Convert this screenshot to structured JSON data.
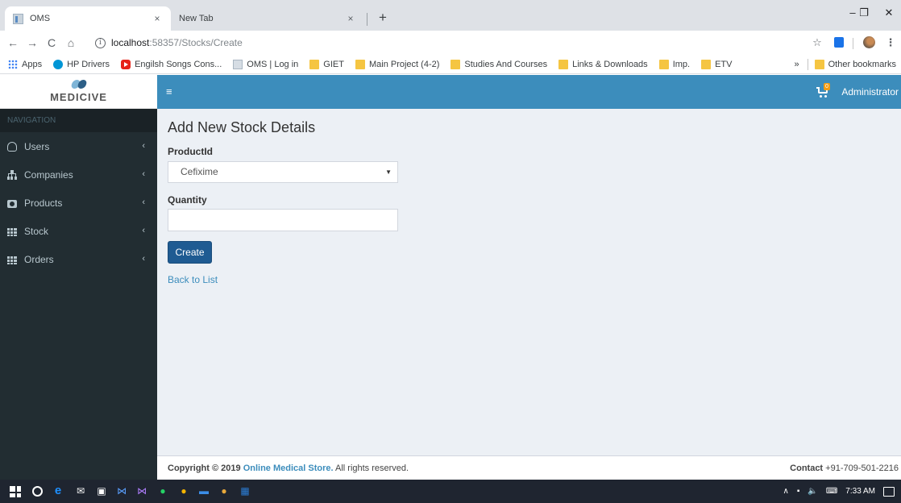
{
  "browser": {
    "tabs": [
      {
        "title": "OMS",
        "active": true
      },
      {
        "title": "New Tab",
        "active": false
      }
    ],
    "new_tab_glyph": "+",
    "close_glyph": "×",
    "window_controls": {
      "minimize": "–",
      "restore": "❐",
      "close": "✕"
    },
    "nav": {
      "back": "←",
      "forward": "→",
      "reload": "C",
      "home": "⌂"
    },
    "url": {
      "host": "localhost",
      "path": ":58357/Stocks/Create",
      "info_glyph": "i"
    },
    "toolbar_icons": [
      "star-icon",
      "download-icon",
      "profile-avatar-icon",
      "kebab-menu-icon"
    ],
    "star_glyph": "☆",
    "kebab_glyph": "⋮",
    "bookmarks": [
      {
        "label": "Apps",
        "icon": "apps-grid-icon"
      },
      {
        "label": "HP Drivers",
        "icon": "hp-icon"
      },
      {
        "label": "Engilsh Songs Cons...",
        "icon": "youtube-icon"
      },
      {
        "label": "OMS | Log in",
        "icon": "page-icon"
      },
      {
        "label": "GIET",
        "icon": "folder-icon"
      },
      {
        "label": "Main Project (4-2)",
        "icon": "folder-icon"
      },
      {
        "label": "Studies And Courses",
        "icon": "folder-icon"
      },
      {
        "label": "Links & Downloads",
        "icon": "folder-icon"
      },
      {
        "label": "Imp.",
        "icon": "folder-icon"
      },
      {
        "label": "ETV",
        "icon": "folder-icon"
      }
    ],
    "bookmarks_overflow": "»",
    "other_bookmarks": "Other bookmarks"
  },
  "app": {
    "logo_text": "MEDICIVE",
    "menu_glyph": "≡",
    "cart_badge": "0",
    "user_name": "Administrator",
    "sidebar": {
      "header": "NAVIGATION",
      "chevron": "‹",
      "items": [
        {
          "label": "Users",
          "icon": "user-icon"
        },
        {
          "label": "Companies",
          "icon": "sitemap-icon"
        },
        {
          "label": "Products",
          "icon": "camera-icon"
        },
        {
          "label": "Stock",
          "icon": "th-grid-icon"
        },
        {
          "label": "Orders",
          "icon": "th-grid-icon"
        }
      ]
    },
    "form": {
      "title": "Add New Stock Details",
      "product_label": "ProductId",
      "product_value": "Cefixime",
      "quantity_label": "Quantity",
      "quantity_value": "",
      "create_button": "Create",
      "back_link": "Back to List"
    },
    "footer": {
      "copyright_prefix": "Copyright © 2019 ",
      "store_name": "Online Medical Store.",
      "copyright_suffix": " All rights reserved.",
      "contact_label": "Contact",
      "contact_value": " +91-709-501-2216"
    },
    "colors": {
      "header_blue": "#3c8dbc",
      "sidebar_dark": "#222d32",
      "button_blue": "#1f5b92",
      "content_bg": "#ecf0f5"
    }
  },
  "taskbar": {
    "time": "7:33 AM",
    "tray_caret": "∧"
  }
}
